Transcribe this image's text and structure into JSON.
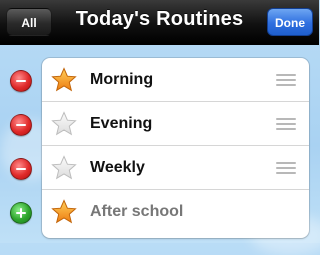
{
  "nav": {
    "title": "Today's Routines",
    "left_button": "All",
    "right_button": "Done"
  },
  "routines": [
    {
      "label": "Morning",
      "star": "filled",
      "action": "delete"
    },
    {
      "label": "Evening",
      "star": "empty",
      "action": "delete"
    },
    {
      "label": "Weekly",
      "star": "empty",
      "action": "delete"
    },
    {
      "label": "After school",
      "star": "filled",
      "action": "add"
    }
  ],
  "colors": {
    "navbar": "#111111",
    "done_button": "#2f6fe0",
    "delete": "#e02a2a",
    "add": "#2ea52c",
    "star_filled": "#f5a21a",
    "star_empty": "#e9e9e9",
    "background": "#b9dcf6"
  },
  "icons": {
    "filled_star": "star-filled-icon",
    "empty_star": "star-empty-icon",
    "delete": "minus-circle-icon",
    "add": "plus-circle-icon",
    "reorder": "reorder-grip-icon"
  }
}
